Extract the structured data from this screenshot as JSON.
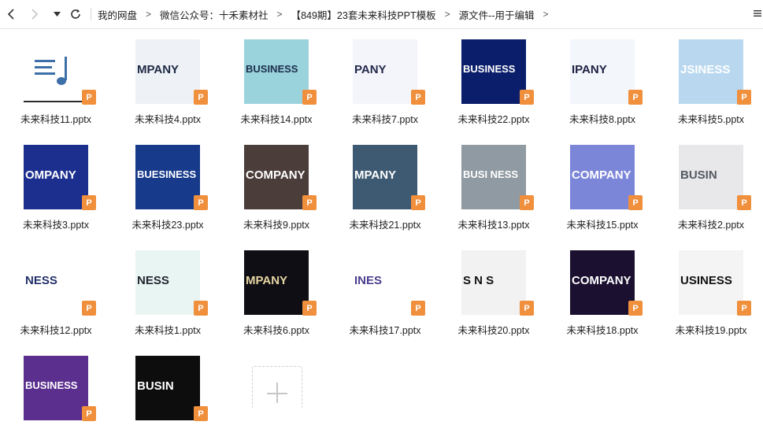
{
  "nav": {
    "back_icon": "chevron-left",
    "forward_icon": "chevron-right",
    "dropdown_icon": "caret-down",
    "refresh_icon": "refresh"
  },
  "breadcrumb": [
    "我的网盘",
    "微信公众号：十禾素材社",
    "【849期】23套未来科技PPT模板",
    "源文件--用于编辑"
  ],
  "view_toggle_icon": "list-view",
  "file_badge": "P",
  "files": [
    {
      "name": "未来科技11.pptx",
      "thumb": "",
      "bg": "#ffffff",
      "fg": "#3d6fa8"
    },
    {
      "name": "未来科技4.pptx",
      "thumb": "MPANY",
      "bg": "#eef1f6",
      "fg": "#1e2a44"
    },
    {
      "name": "未来科技14.pptx",
      "thumb": "BUSINESS",
      "bg": "#9bd3dc",
      "fg": "#1a2d4a"
    },
    {
      "name": "未来科技7.pptx",
      "thumb": "PANY",
      "bg": "#f4f4fb",
      "fg": "#232a4a"
    },
    {
      "name": "未来科技22.pptx",
      "thumb": "BUSINESS",
      "bg": "#0b1e6b",
      "fg": "#ffffff"
    },
    {
      "name": "未来科技8.pptx",
      "thumb": "IPANY",
      "bg": "#f3f6fb",
      "fg": "#1a2040"
    },
    {
      "name": "未来科技5.pptx",
      "thumb": "JSINESS",
      "bg": "#b9d8ef",
      "fg": "#ffffff"
    },
    {
      "name": "未来科技3.pptx",
      "thumb": "OMPANY",
      "bg": "#1d2f8e",
      "fg": "#ffffff"
    },
    {
      "name": "未来科技23.pptx",
      "thumb": "BUESINESS",
      "bg": "#183a8a",
      "fg": "#ffffff"
    },
    {
      "name": "未来科技9.pptx",
      "thumb": "COMPANY",
      "bg": "#4a3d3a",
      "fg": "#ffffff"
    },
    {
      "name": "未来科技21.pptx",
      "thumb": "MPANY",
      "bg": "#3d5a72",
      "fg": "#ffffff"
    },
    {
      "name": "未来科技13.pptx",
      "thumb": "BUSI NESS",
      "bg": "#8f9aa2",
      "fg": "#ffffff"
    },
    {
      "name": "未来科技15.pptx",
      "thumb": "COMPANY",
      "bg": "#7c86d8",
      "fg": "#ffffff"
    },
    {
      "name": "未来科技2.pptx",
      "thumb": "BUSIN",
      "bg": "#e8e8ea",
      "fg": "#555a62"
    },
    {
      "name": "未来科技12.pptx",
      "thumb": "NESS",
      "bg": "#ffffff",
      "fg": "#23306a"
    },
    {
      "name": "未来科技1.pptx",
      "thumb": "NESS",
      "bg": "#e9f5f3",
      "fg": "#222630"
    },
    {
      "name": "未来科技6.pptx",
      "thumb": "MPANY",
      "bg": "#0e0e14",
      "fg": "#e8d6a4"
    },
    {
      "name": "未来科技17.pptx",
      "thumb": "INES",
      "bg": "#ffffff",
      "fg": "#4b3f8f"
    },
    {
      "name": "未来科技20.pptx",
      "thumb": "S N S",
      "bg": "#f2f2f2",
      "fg": "#111111"
    },
    {
      "name": "未来科技18.pptx",
      "thumb": "COMPANY",
      "bg": "#1b1030",
      "fg": "#ffffff"
    },
    {
      "name": "未来科技19.pptx",
      "thumb": "USINESS",
      "bg": "#f4f4f4",
      "fg": "#111111"
    },
    {
      "name": "",
      "thumb": "BUSINESS",
      "bg": "#5a2f8e",
      "fg": "#ffffff"
    },
    {
      "name": "",
      "thumb": "BUSIN",
      "bg": "#0d0d0d",
      "fg": "#ffffff"
    }
  ],
  "new_item_icon": "plus-icon"
}
